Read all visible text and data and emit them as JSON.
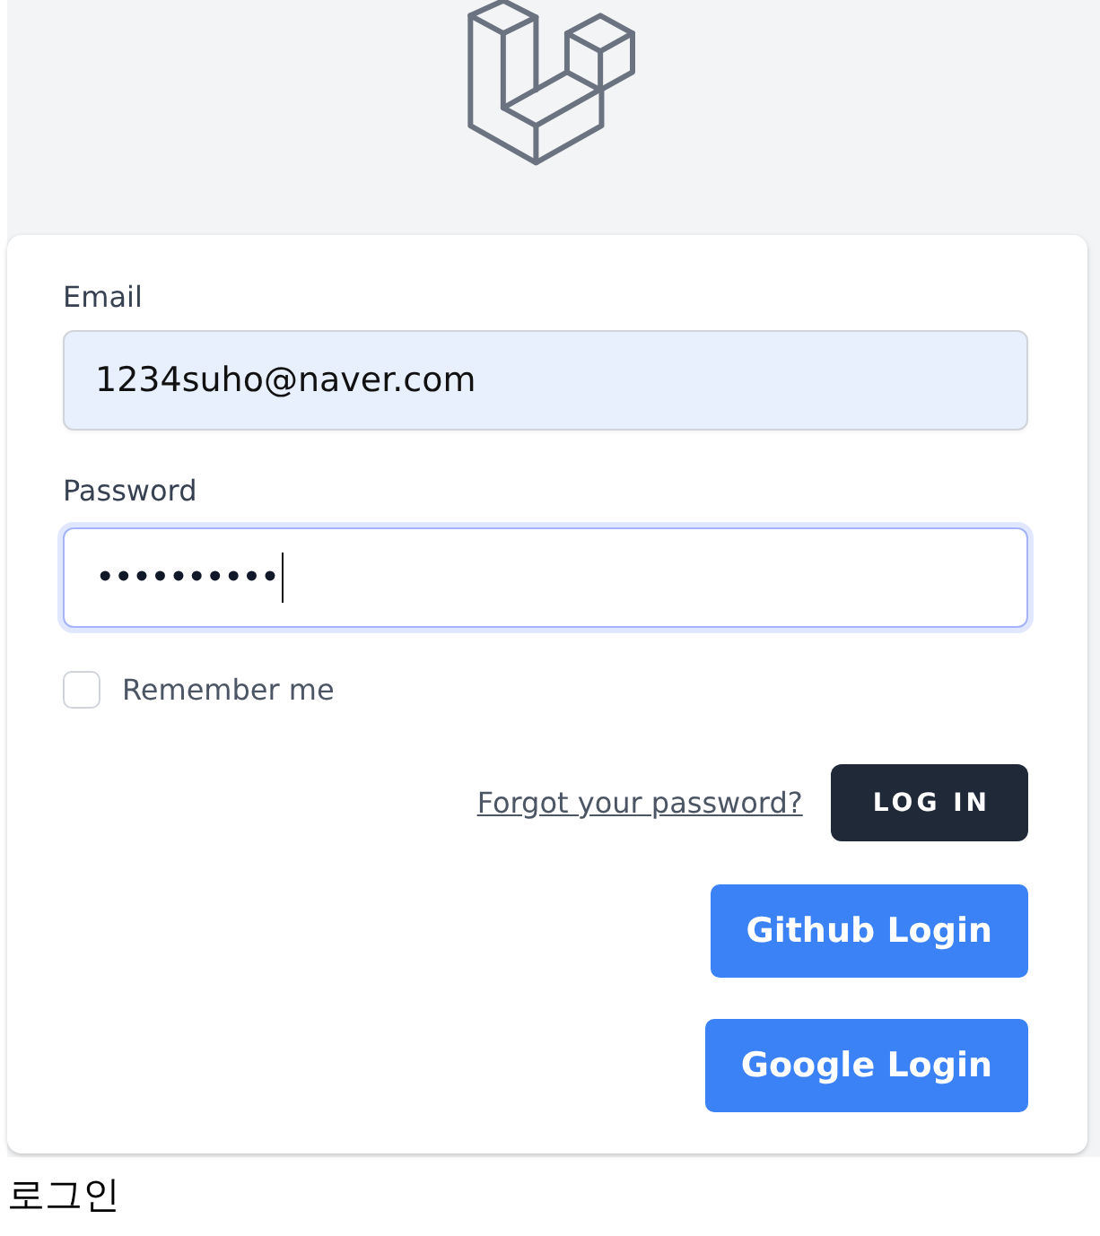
{
  "form": {
    "email": {
      "label": "Email",
      "value": "1234suho@naver.com",
      "autofilled": true
    },
    "password": {
      "label": "Password",
      "value": "••••••••••",
      "focused": true
    },
    "remember": {
      "label": "Remember me",
      "checked": false
    },
    "forgot_link": "Forgot your password?",
    "login_button": "LOG IN",
    "social_buttons": [
      {
        "label": "Github Login"
      },
      {
        "label": "Google Login"
      }
    ]
  },
  "footer_text": "로그인"
}
